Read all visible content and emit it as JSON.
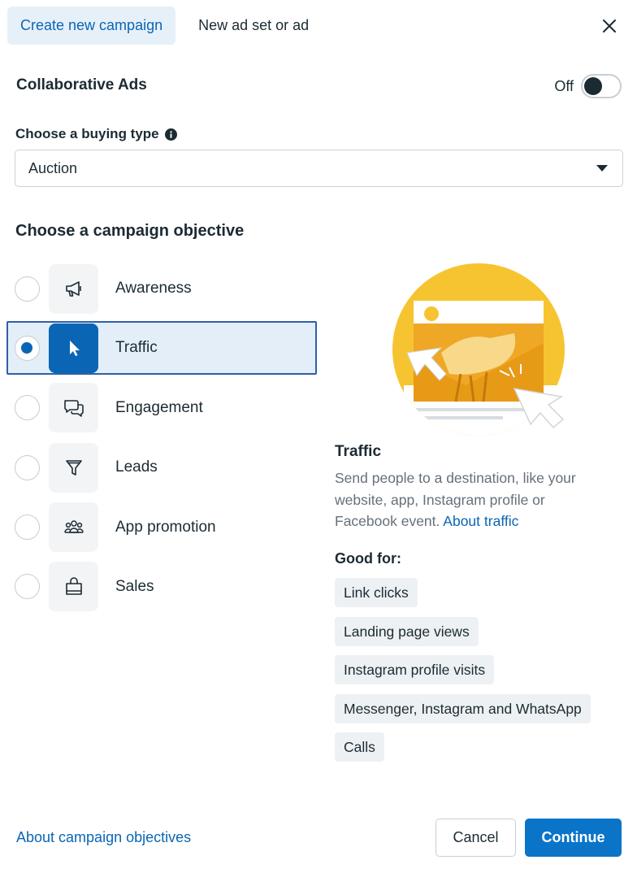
{
  "tabs": [
    {
      "label": "Create new campaign",
      "active": true
    },
    {
      "label": "New ad set or ad",
      "active": false
    }
  ],
  "collaborative_ads": {
    "label": "Collaborative Ads",
    "toggle_state_label": "Off",
    "enabled": false
  },
  "buying_type": {
    "label": "Choose a buying type",
    "value": "Auction",
    "icon": "info-icon"
  },
  "objective_heading": "Choose a campaign objective",
  "objectives": [
    {
      "label": "Awareness",
      "icon": "megaphone-icon",
      "selected": false
    },
    {
      "label": "Traffic",
      "icon": "cursor-icon",
      "selected": true
    },
    {
      "label": "Engagement",
      "icon": "chat-bubbles-icon",
      "selected": false
    },
    {
      "label": "Leads",
      "icon": "funnel-icon",
      "selected": false
    },
    {
      "label": "App promotion",
      "icon": "people-icon",
      "selected": false
    },
    {
      "label": "Sales",
      "icon": "shopping-bag-icon",
      "selected": false
    }
  ],
  "detail": {
    "title": "Traffic",
    "description": "Send people to a destination, like your website, app, Instagram profile or Facebook event.",
    "link_label": "About traffic",
    "good_for_label": "Good for:",
    "good_for": [
      "Link clicks",
      "Landing page views",
      "Instagram profile visits",
      "Messenger, Instagram and WhatsApp",
      "Calls"
    ]
  },
  "footer": {
    "about_link": "About campaign objectives",
    "cancel_label": "Cancel",
    "continue_label": "Continue"
  },
  "colors": {
    "accent": "#0a66b4",
    "illustration_yellow": "#f7c431",
    "selected_bg": "#e3eef8"
  }
}
